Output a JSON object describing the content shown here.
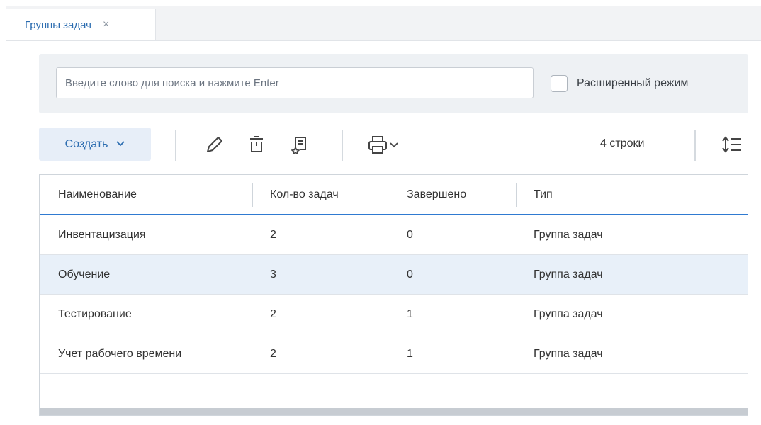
{
  "tabs": [
    {
      "label": "Группы задач",
      "close": "×"
    }
  ],
  "search": {
    "placeholder": "Введите слово для поиска и нажмите Enter",
    "value": "",
    "advanced_label": "Расширенный режим",
    "advanced_checked": false
  },
  "toolbar": {
    "create_label": "Создать",
    "icons": [
      "pencil-icon",
      "trash-icon",
      "bookmark-note-icon",
      "printer-icon",
      "chevron-down-icon",
      "row-height-icon"
    ],
    "rows_count": "4 строки"
  },
  "table": {
    "columns": [
      "Наименование",
      "Кол-во задач",
      "Завершено",
      "Тип"
    ],
    "rows": [
      {
        "name": "Инвентацизация",
        "count": "2",
        "done": "0",
        "type": "Группа задач",
        "selected": false
      },
      {
        "name": "Обучение",
        "count": "3",
        "done": "0",
        "type": "Группа задач",
        "selected": true
      },
      {
        "name": "Тестирование",
        "count": "2",
        "done": "1",
        "type": "Группа задач",
        "selected": false
      },
      {
        "name": "Учет рабочего времени",
        "count": "2",
        "done": "1",
        "type": "Группа задач",
        "selected": false
      }
    ]
  },
  "colors": {
    "accent": "#2b6cb0",
    "header_underline": "#2f7ad1",
    "selected_row": "#e8f0f9",
    "panel_bg": "#eef1f4"
  }
}
